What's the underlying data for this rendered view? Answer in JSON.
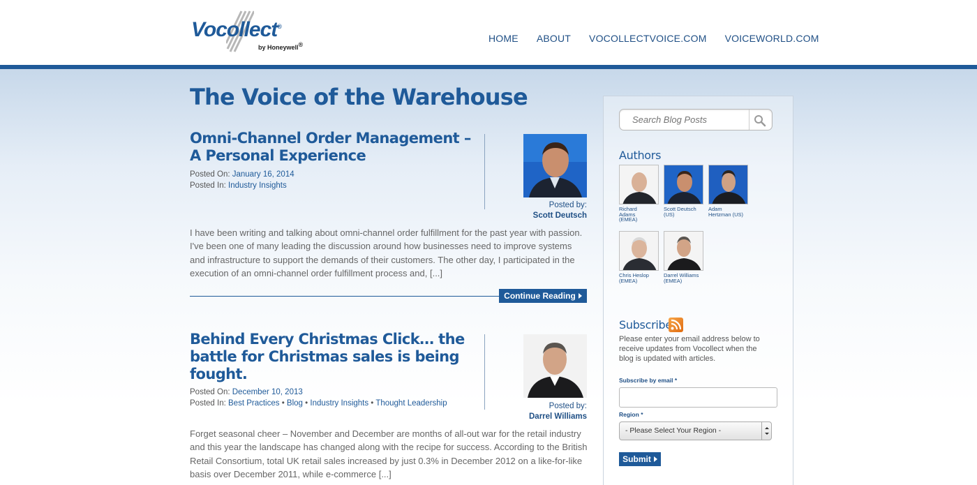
{
  "logo": {
    "name": "Vocollect",
    "registered": "®",
    "sub": "by Honeywell",
    "sub_reg": "®"
  },
  "nav": {
    "items": [
      "HOME",
      "ABOUT",
      "VOCOLLECTVOICE.COM",
      "VOICEWORLD.COM"
    ]
  },
  "blog": {
    "title": "The Voice of the Warehouse"
  },
  "posts": [
    {
      "title": "Omni-Channel Order Management – A Personal Experience",
      "posted_on_label": "Posted On:",
      "posted_on": "January 16, 2014",
      "posted_in_label": "Posted In:",
      "categories": [
        "Industry Insights"
      ],
      "posted_by_label": "Posted by:",
      "author": "Scott Deutsch",
      "excerpt": "I have been writing and talking about omni-channel order fulfillment for the past year with passion. I've been one of many leading the discussion around how businesses need to improve systems and infrastructure to support the demands of their customers. The other day, I participated in the execution of an omni-channel order fulfillment process and, [...]",
      "continue_label": "Continue Reading"
    },
    {
      "title": "Behind Every Christmas Click… the battle for Christmas sales is being fought.",
      "posted_on_label": "Posted On:",
      "posted_on": "December 10, 2013",
      "posted_in_label": "Posted In:",
      "categories": [
        "Best Practices",
        "Blog",
        "Industry Insights",
        "Thought Leadership"
      ],
      "category_separator": " • ",
      "posted_by_label": "Posted by:",
      "author": "Darrel Williams",
      "excerpt": "Forget seasonal cheer – November and December are months of all-out war for the retail industry and this year the landscape has changed along with the recipe for success. According to the British Retail Consortium, total UK retail sales increased by just 0.3% in December 2012 on a like-for-like basis over December 2011, while e-commerce [...]"
    }
  ],
  "sidebar": {
    "search": {
      "placeholder": "Search Blog Posts"
    },
    "authors_heading": "Authors",
    "authors": [
      {
        "name": "Richard Adams (EMEA)",
        "lines": [
          "Richard",
          "Adams",
          "(EMEA)"
        ]
      },
      {
        "name": "Scott Deutsch (US)",
        "lines": [
          "Scott Deutsch",
          "(US)"
        ]
      },
      {
        "name": "Adam Hertzman (US)",
        "lines": [
          "Adam",
          "Hertzman (US)"
        ]
      },
      {
        "name": "Chris Heslop (EMEA)",
        "lines": [
          "Chris Heslop",
          "(EMEA)"
        ]
      },
      {
        "name": "Darrel Williams (EMEA)",
        "lines": [
          "Darrel Williams",
          "(EMEA)"
        ]
      }
    ],
    "subscribe_heading": "Subscribe",
    "subscribe_text": "Please enter your email address below to receive updates from Vocollect when the blog is updated with articles.",
    "email_label": "Subscribe by email",
    "region_label": "Region",
    "required_mark": "*",
    "region_selected": "- Please Select Your Region -",
    "submit_label": "Submit"
  },
  "colors": {
    "brand": "#1f5a99",
    "text": "#666666",
    "accent_rss": "#e9821f"
  },
  "icons": [
    "search-icon",
    "rss-icon",
    "arrow-right-icon"
  ]
}
